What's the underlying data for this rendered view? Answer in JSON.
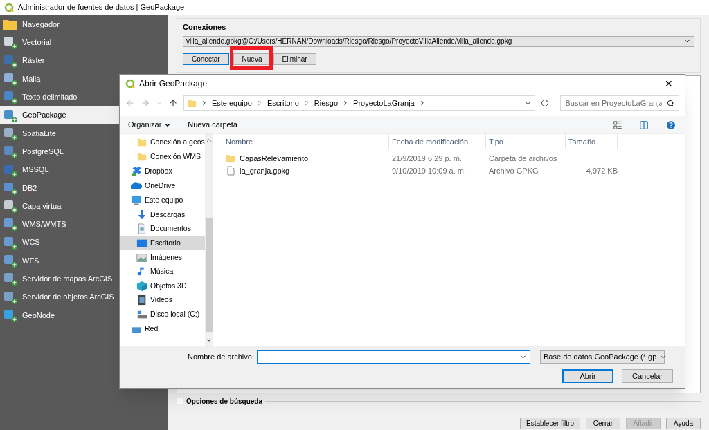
{
  "window": {
    "title": "Administrador de fuentes de datos | GeoPackage"
  },
  "sidebar": {
    "items": [
      {
        "label": "Navegador",
        "selected": false
      },
      {
        "label": "Vectorial",
        "selected": false
      },
      {
        "label": "Ráster",
        "selected": false
      },
      {
        "label": "Malla",
        "selected": false
      },
      {
        "label": "Texto delimitado",
        "selected": false
      },
      {
        "label": "GeoPackage",
        "selected": true
      },
      {
        "label": "SpatiaLite",
        "selected": false
      },
      {
        "label": "PostgreSQL",
        "selected": false
      },
      {
        "label": "MSSQL",
        "selected": false
      },
      {
        "label": "DB2",
        "selected": false
      },
      {
        "label": "Capa virtual",
        "selected": false
      },
      {
        "label": "WMS/WMTS",
        "selected": false
      },
      {
        "label": "WCS",
        "selected": false
      },
      {
        "label": "WFS",
        "selected": false
      },
      {
        "label": "Servidor de mapas ArcGIS",
        "selected": false
      },
      {
        "label": "Servidor de objetos ArcGIS",
        "selected": false
      },
      {
        "label": "GeoNode",
        "selected": false
      }
    ]
  },
  "connections": {
    "title": "Conexiones",
    "value": "villa_allende.gpkg@C:/Users/HERNAN/Downloads/Riesgo/Riesgo/ProyectoVillaAllende/villa_allende.gpkg",
    "buttons": [
      {
        "label": "Conectar",
        "highlighted": false
      },
      {
        "label": "Nueva",
        "highlighted": true
      },
      {
        "label": "Eliminar",
        "highlighted": false
      }
    ]
  },
  "search_options": {
    "label": "Opciones de búsqueda",
    "checked": false
  },
  "footer_buttons": [
    {
      "label": "Establecer filtro",
      "disabled": false
    },
    {
      "label": "Cerrar",
      "disabled": false
    },
    {
      "label": "Añadir",
      "disabled": true
    },
    {
      "label": "Ayuda",
      "disabled": false
    }
  ],
  "dialog": {
    "title": "Abrir GeoPackage",
    "close": "✕",
    "breadcrumb": [
      "Este equipo",
      "Escritorio",
      "Riesgo",
      "ProyectoLaGranja"
    ],
    "search": {
      "placeholder": "Buscar en ProyectoLaGranja"
    },
    "toolbar": {
      "organize": "Organizar",
      "new_folder": "Nueva carpeta"
    },
    "nav": [
      {
        "label": "Conexión a geos",
        "kind": "folder",
        "selected": false
      },
      {
        "label": "Conexión WMS_",
        "kind": "folder",
        "selected": false
      },
      {
        "label": "Dropbox",
        "kind": "dropbox",
        "selected": false
      },
      {
        "label": "OneDrive",
        "kind": "cloud",
        "selected": false
      },
      {
        "label": "Este equipo",
        "kind": "pc",
        "selected": false,
        "children": [
          {
            "label": "Descargas",
            "kind": "download",
            "selected": false
          },
          {
            "label": "Documentos",
            "kind": "document",
            "selected": false
          },
          {
            "label": "Escritorio",
            "kind": "desktop",
            "selected": true
          },
          {
            "label": "Imágenes",
            "kind": "image",
            "selected": false
          },
          {
            "label": "Música",
            "kind": "music",
            "selected": false
          },
          {
            "label": "Objetos 3D",
            "kind": "cube",
            "selected": false
          },
          {
            "label": "Videos",
            "kind": "video",
            "selected": false
          },
          {
            "label": "Disco local (C:)",
            "kind": "drive",
            "selected": false
          }
        ]
      },
      {
        "label": "Red",
        "kind": "network",
        "selected": false
      }
    ],
    "columns": [
      "Nombre",
      "Fecha de modificación",
      "Tipo",
      "Tamaño"
    ],
    "files": [
      {
        "kind": "folder",
        "name": "CapasRelevamiento",
        "date": "21/9/2019 6:29 p. m.",
        "type": "Carpeta de archivos"
      },
      {
        "kind": "file",
        "name": "la_granja.gpkg",
        "date": "9/10/2019 10:09 a. m.",
        "type": "Archivo GPKG",
        "size": "4,972 KB"
      }
    ],
    "filename_label": "Nombre de archivo:",
    "filetype": "Base de datos GeoPackage (*.gp",
    "open": "Abrir",
    "cancel": "Cancelar"
  }
}
